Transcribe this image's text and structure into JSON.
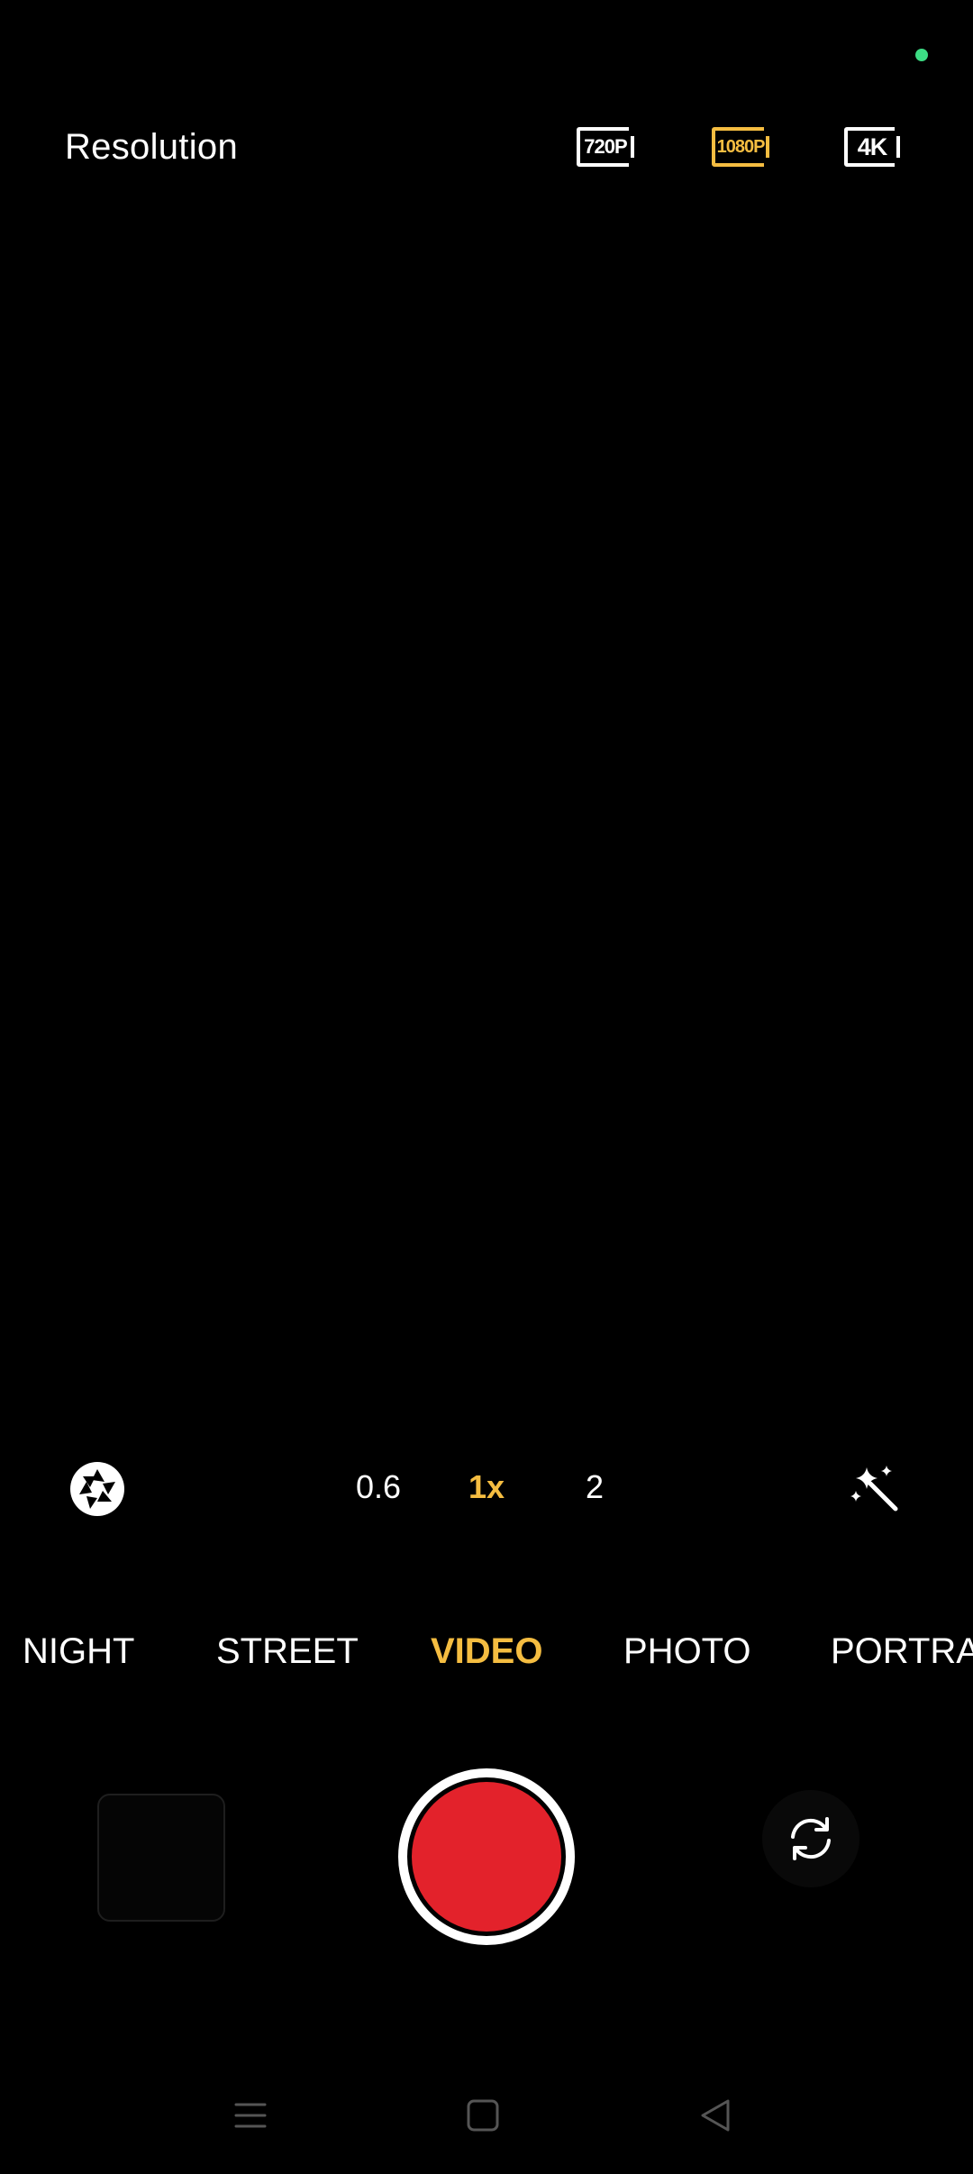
{
  "colors": {
    "accent": "#F5BD41",
    "record": "#E3222B",
    "status_dot": "#3DDC84",
    "nav": "#555555"
  },
  "resolution": {
    "title": "Resolution",
    "options": [
      {
        "label": "720P",
        "icon": "resolution-720p-icon",
        "selected": false
      },
      {
        "label": "1080P",
        "icon": "resolution-1080p-icon",
        "selected": true
      },
      {
        "label": "4K",
        "icon": "resolution-4k-icon",
        "selected": false
      }
    ]
  },
  "zoom": {
    "left_icon": "aperture-icon",
    "right_icon": "magic-wand-icon",
    "options": [
      {
        "label": "0.6",
        "selected": false
      },
      {
        "label": "1x",
        "selected": true
      },
      {
        "label": "2",
        "selected": false
      }
    ]
  },
  "modes": [
    {
      "label": "NIGHT",
      "selected": false
    },
    {
      "label": "STREET",
      "selected": false
    },
    {
      "label": "VIDEO",
      "selected": true
    },
    {
      "label": "PHOTO",
      "selected": false
    },
    {
      "label": "PORTRAIT",
      "selected": false
    }
  ],
  "controls": {
    "gallery_icon": "gallery-thumbnail",
    "record_icon": "record-button",
    "flip_icon": "switch-camera-icon"
  },
  "navbar": {
    "icons": [
      "menu-icon",
      "home-icon",
      "back-icon"
    ]
  }
}
